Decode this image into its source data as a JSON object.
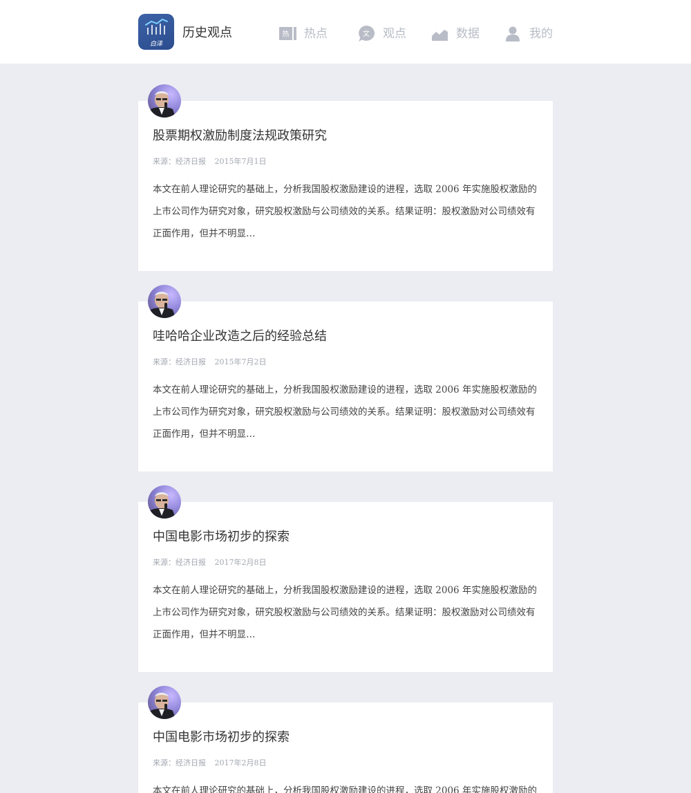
{
  "header": {
    "app_title": "历史观点",
    "logo_text": "白泽",
    "nav": [
      {
        "label": "热点",
        "icon": "hot-icon",
        "icon_text": "热"
      },
      {
        "label": "观点",
        "icon": "opinion-icon",
        "icon_text": "文"
      },
      {
        "label": "数据",
        "icon": "chart-icon"
      },
      {
        "label": "我的",
        "icon": "user-icon"
      }
    ]
  },
  "articles": [
    {
      "title": "股票期权激励制度法规政策研究",
      "source": "来源：经济日报",
      "date": "2015年7月1日",
      "summary": "本文在前人理论研究的基础上，分析我国股权激励建设的进程，选取 2006 年实施股权激励的上市公司作为研究对象，研究股权激励与公司绩效的关系。结果证明：股权激励对公司绩效有正面作用，但并不明显…"
    },
    {
      "title": "哇哈哈企业改造之后的经验总结",
      "source": "来源：经济日报",
      "date": "2015年7月2日",
      "summary": "本文在前人理论研究的基础上，分析我国股权激励建设的进程，选取 2006 年实施股权激励的上市公司作为研究对象，研究股权激励与公司绩效的关系。结果证明：股权激励对公司绩效有正面作用，但并不明显…"
    },
    {
      "title": "中国电影市场初步的探索",
      "source": "来源：经济日报",
      "date": "2017年2月8日",
      "summary": "本文在前人理论研究的基础上，分析我国股权激励建设的进程，选取 2006 年实施股权激励的上市公司作为研究对象，研究股权激励与公司绩效的关系。结果证明：股权激励对公司绩效有正面作用，但并不明显…"
    },
    {
      "title": "中国电影市场初步的探索",
      "source": "来源：经济日报",
      "date": "2017年2月8日",
      "summary": "本文在前人理论研究的基础上，分析我国股权激励建设的进程，选取 2006 年实施股权激励的上市公司作为研究对象，研究股权激励与公司绩效的关系。结果证明：股权激励对公司绩效有正面作用，但并不明显…"
    }
  ],
  "colors": {
    "background": "#ebedf2",
    "logo": "#3d62a6",
    "nav_inactive": "#b8bcc6",
    "title_text": "#333333",
    "meta_text": "#a3a7b0"
  }
}
